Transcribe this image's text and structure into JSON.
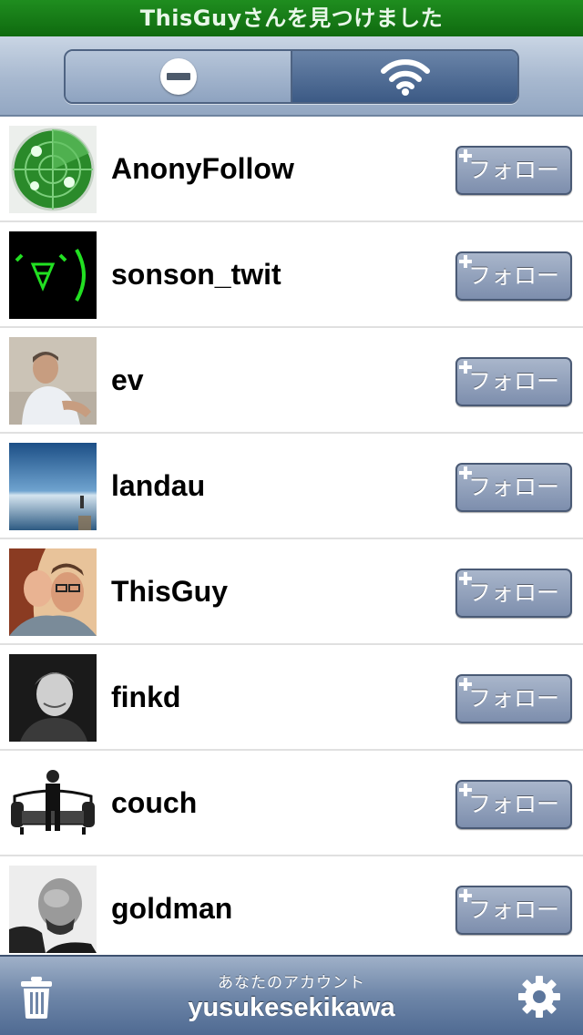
{
  "banner": {
    "text": "ThisGuyさんを見つけました"
  },
  "segmented": {
    "items": [
      {
        "icon": "minus-circle-icon",
        "selected": false
      },
      {
        "icon": "wifi-icon",
        "selected": true
      }
    ]
  },
  "users": [
    {
      "name": "AnonyFollow",
      "follow_label": "フォロー",
      "avatar": "radar-avatar"
    },
    {
      "name": "sonson_twit",
      "follow_label": "フォロー",
      "avatar": "emoticon-avatar"
    },
    {
      "name": "ev",
      "follow_label": "フォロー",
      "avatar": "photo-avatar"
    },
    {
      "name": "landau",
      "follow_label": "フォロー",
      "avatar": "horizon-photo-avatar"
    },
    {
      "name": "ThisGuy",
      "follow_label": "フォロー",
      "avatar": "couple-photo-avatar"
    },
    {
      "name": "finkd",
      "follow_label": "フォロー",
      "avatar": "bw-photo-avatar"
    },
    {
      "name": "couch",
      "follow_label": "フォロー",
      "avatar": "couch-illustration-avatar"
    },
    {
      "name": "goldman",
      "follow_label": "フォロー",
      "avatar": "bw-portrait-avatar"
    }
  ],
  "bottom": {
    "account_label": "あなたのアカウント",
    "account_name": "yusukesekikawa",
    "left_icon": "trash-icon",
    "right_icon": "gear-icon"
  },
  "colors": {
    "banner": "#1a7f1a",
    "toolbar": "#a7b8cf",
    "follow_button": "#8e9cb8",
    "bottom_bar": "#5c769c"
  }
}
